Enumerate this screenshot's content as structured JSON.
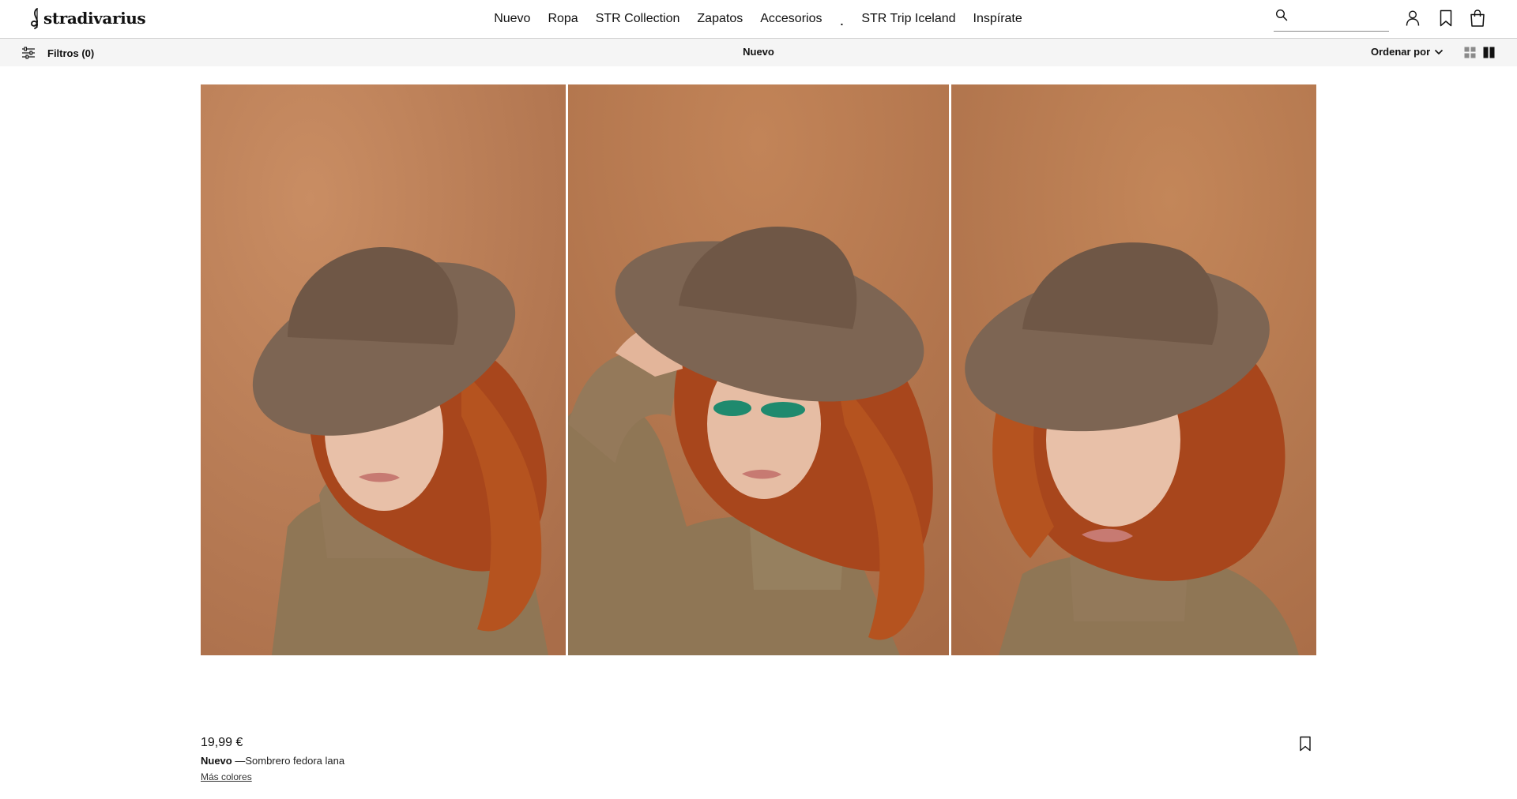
{
  "brand": {
    "logo_text": "stradivarius"
  },
  "nav": {
    "items": [
      {
        "label": "Nuevo"
      },
      {
        "label": "Ropa"
      },
      {
        "label": "STR Collection"
      },
      {
        "label": "Zapatos"
      },
      {
        "label": "Accesorios"
      },
      {
        "label": "."
      },
      {
        "label": "STR Trip Iceland"
      },
      {
        "label": "Inspírate"
      }
    ]
  },
  "search": {
    "value": "",
    "placeholder": ""
  },
  "header_icons": [
    "search-icon",
    "user-icon",
    "bookmark-icon",
    "shopping-bag-icon"
  ],
  "subbar": {
    "filters_label": "Filtros (0)",
    "title": "Nuevo",
    "sort_label": "Ordenar por",
    "view_icons": [
      "grid-4-icon",
      "grid-2-icon"
    ]
  },
  "product": {
    "price": "19,99 €",
    "badge": "Nuevo",
    "name": " —Sombrero fedora lana",
    "more_colors": "Más colores",
    "images": [
      "product-photo-1",
      "product-photo-2",
      "product-photo-3"
    ]
  },
  "colors": {
    "text": "#111111",
    "subbar_bg": "#f5f5f5",
    "photo_backdrop": "#b97a53",
    "hat": "#7d6553",
    "hair": "#a8461c",
    "sweater": "#8f7655",
    "eyeshadow": "#1f8a6e"
  }
}
